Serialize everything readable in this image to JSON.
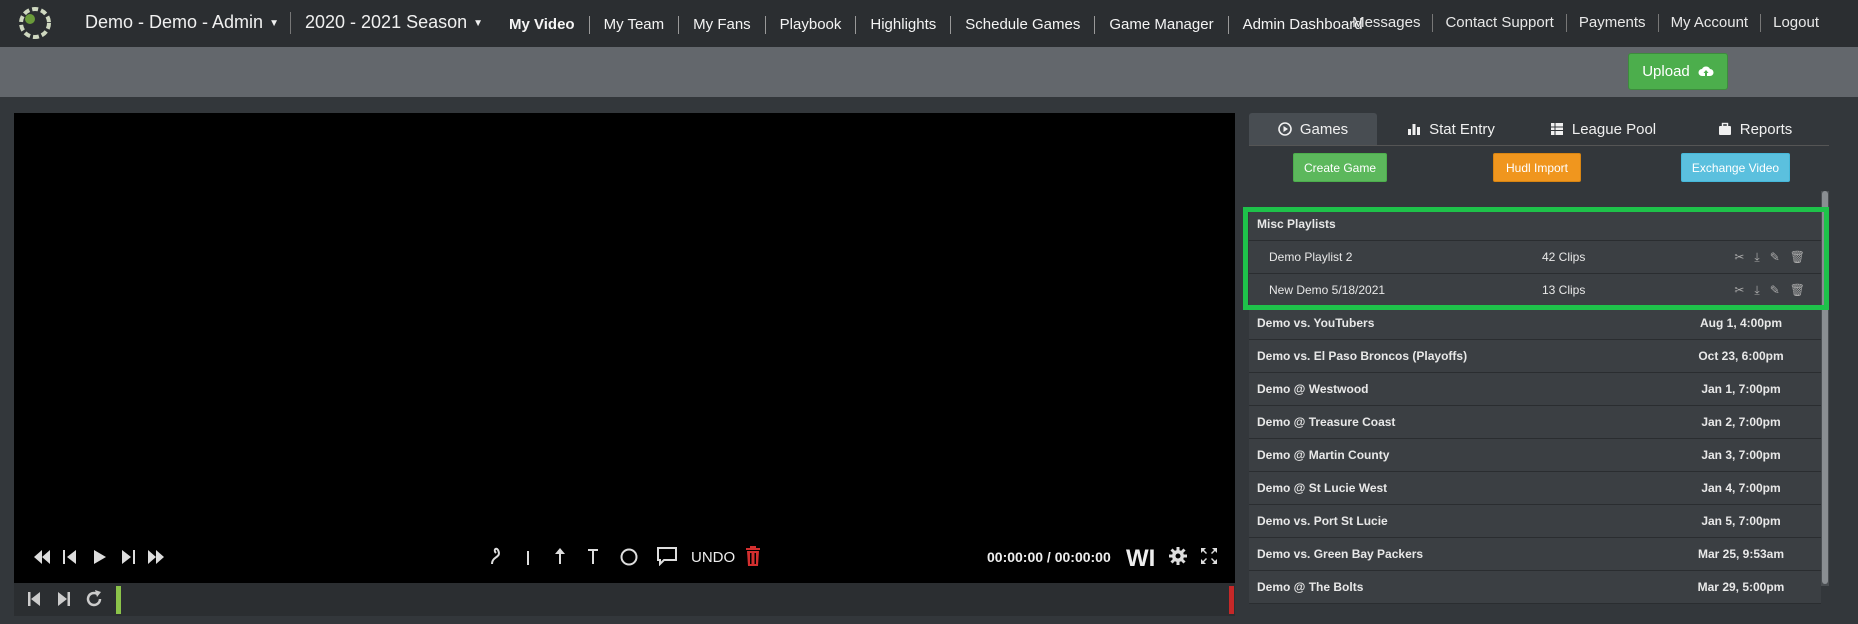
{
  "header": {
    "team": "Demo - Demo - Admin",
    "season": "2020 - 2021 Season",
    "links": [
      "Messages",
      "Contact Support",
      "Payments",
      "My Account",
      "Logout"
    ]
  },
  "nav": {
    "items": [
      "My Video",
      "My Team",
      "My Fans",
      "Playbook",
      "Highlights",
      "Schedule Games",
      "Game Manager",
      "Admin Dashboard"
    ],
    "upload_label": "Upload"
  },
  "player": {
    "time": "00:00:00 / 00:00:00",
    "undo_label": "UNDO",
    "wi_label": "WI"
  },
  "tabs": [
    "Games",
    "Stat Entry",
    "League Pool",
    "Reports"
  ],
  "actions": {
    "create": "Create Game",
    "hudl": "Hudl Import",
    "exchange": "Exchange Video"
  },
  "playlists": {
    "title": "Misc Playlists",
    "items": [
      {
        "name": "Demo Playlist 2",
        "clips": "42 Clips"
      },
      {
        "name": "New Demo 5/18/2021",
        "clips": "13 Clips"
      }
    ]
  },
  "games": [
    {
      "name": "Demo vs. YouTubers",
      "date": "Aug 1, 4:00pm"
    },
    {
      "name": "Demo vs. El Paso Broncos (Playoffs)",
      "date": "Oct 23, 6:00pm"
    },
    {
      "name": "Demo @ Westwood",
      "date": "Jan 1, 7:00pm"
    },
    {
      "name": "Demo @ Treasure Coast",
      "date": "Jan 2, 7:00pm"
    },
    {
      "name": "Demo @ Martin County",
      "date": "Jan 3, 7:00pm"
    },
    {
      "name": "Demo @ St Lucie West",
      "date": "Jan 4, 7:00pm"
    },
    {
      "name": "Demo vs. Port St Lucie",
      "date": "Jan 5, 7:00pm"
    },
    {
      "name": "Demo vs. Green Bay Packers",
      "date": "Mar 25, 9:53am"
    },
    {
      "name": "Demo @ The Bolts",
      "date": "Mar 29, 5:00pm"
    }
  ],
  "colors": {
    "highlight": "#1ec24a",
    "create": "#5cb85c",
    "hudl": "#f0961e",
    "exchange": "#5bc0de",
    "upload": "#4cae4c"
  }
}
